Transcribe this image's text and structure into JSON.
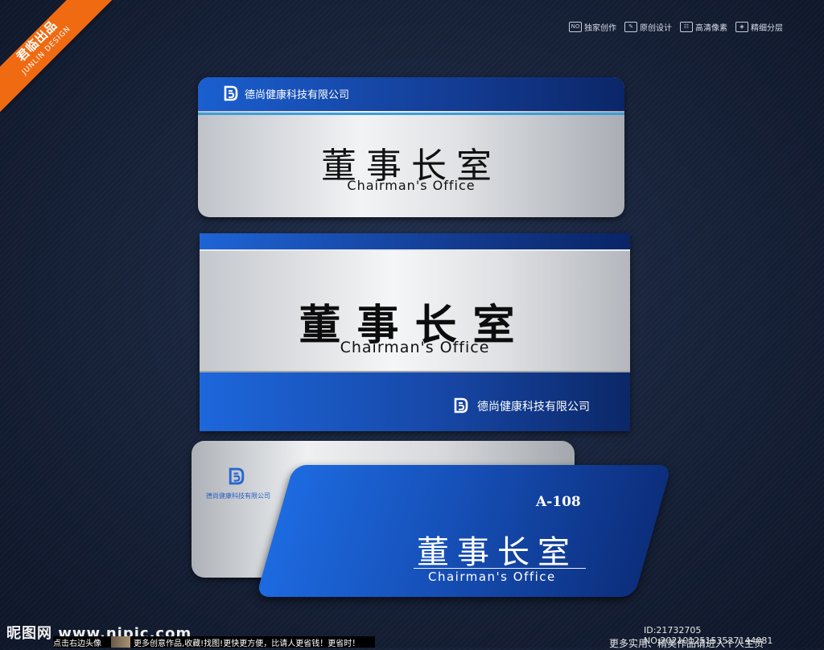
{
  "watermark": {
    "ribbon_cn": "君临出品",
    "ribbon_en": "JUNLIN DESIGN"
  },
  "badges": [
    {
      "icon": "NO",
      "label": "独家创作"
    },
    {
      "icon": "pencil-icon",
      "label": "原创设计"
    },
    {
      "icon": "grid-icon",
      "label": "高清像素"
    },
    {
      "icon": "layers-icon",
      "label": "精细分层"
    }
  ],
  "company_name": "德尚健康科技有限公司",
  "plate1": {
    "title": "董事长室",
    "subtitle": "Chairman's Office"
  },
  "plate2": {
    "title": "董事长室",
    "subtitle": "Chairman's Office"
  },
  "plate3": {
    "room_code": "A-108",
    "title": "董事长室",
    "subtitle": "Chairman's Office"
  },
  "footer": {
    "site_logo": "昵图网",
    "site_url": "www.nipic.com",
    "left_hint": "点击右边头像",
    "right_hint": "更多创意作品,收藏!找图!更快更方便，比请人更省钱！更省时！",
    "id_line": "ID:21732705 NO:20210125153527144081",
    "homepage_hint": "更多实用、精美作品请进入个人主页"
  },
  "colors": {
    "blue_primary": "#1a5fd0",
    "blue_dark": "#0b2668",
    "accent_orange": "#f06a12"
  }
}
